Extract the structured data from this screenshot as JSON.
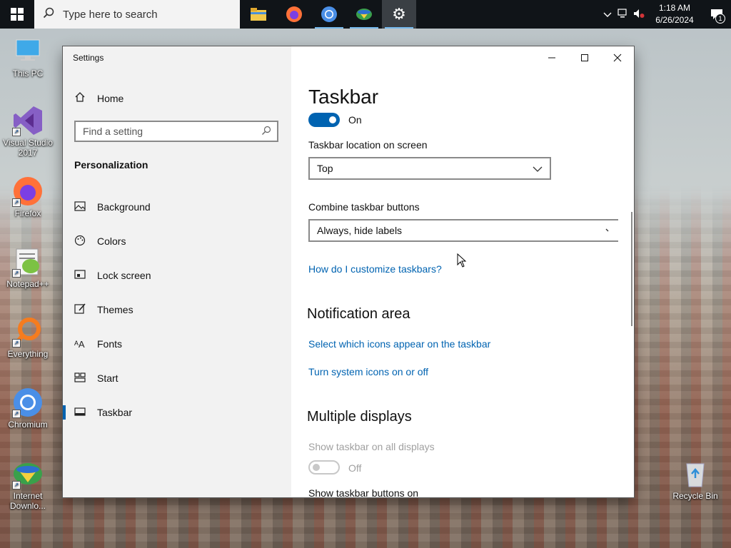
{
  "taskbar": {
    "search_placeholder": "Type here to search",
    "clock_time": "1:18 AM",
    "clock_date": "6/26/2024",
    "notification_count": "1",
    "accent": "#76b9ed"
  },
  "desktop": {
    "icons": [
      {
        "label": "This PC"
      },
      {
        "label": "Visual Studio 2017"
      },
      {
        "label": "Firefox"
      },
      {
        "label": "Notepad++"
      },
      {
        "label": "Everything"
      },
      {
        "label": "Chromium"
      },
      {
        "label": "Internet Downlo..."
      },
      {
        "label": "Recycle Bin"
      }
    ]
  },
  "window": {
    "title": "Settings",
    "nav": {
      "home_label": "Home",
      "search_placeholder": "Find a setting",
      "section_title": "Personalization",
      "items": [
        {
          "label": "Background",
          "icon": "picture-icon"
        },
        {
          "label": "Colors",
          "icon": "palette-icon"
        },
        {
          "label": "Lock screen",
          "icon": "lock-screen-icon"
        },
        {
          "label": "Themes",
          "icon": "brush-icon"
        },
        {
          "label": "Fonts",
          "icon": "fonts-icon"
        },
        {
          "label": "Start",
          "icon": "start-icon"
        },
        {
          "label": "Taskbar",
          "icon": "taskbar-icon",
          "selected": true
        }
      ]
    },
    "content": {
      "heading": "Taskbar",
      "toggle_top_state": "On",
      "location_label": "Taskbar location on screen",
      "location_value": "Top",
      "combine_label": "Combine taskbar buttons",
      "combine_value": "Always, hide labels",
      "customize_link": "How do I customize taskbars?",
      "notification_heading": "Notification area",
      "select_icons_link": "Select which icons appear on the taskbar",
      "system_icons_link": "Turn system icons on or off",
      "multiple_heading": "Multiple displays",
      "show_all_label": "Show taskbar on all displays",
      "show_all_state": "Off",
      "show_buttons_label": "Show taskbar buttons on"
    }
  },
  "colors": {
    "accent": "#0063b1",
    "link": "#0063b1",
    "nav_bg": "#f2f2f2"
  }
}
